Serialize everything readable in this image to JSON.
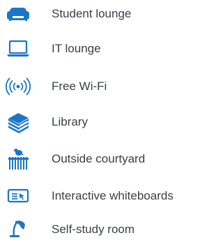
{
  "accent_color": "#1d75c8",
  "text_color": "#3a3f47",
  "amenities": [
    {
      "icon": "sofa-icon",
      "label": "Student lounge"
    },
    {
      "icon": "laptop-icon",
      "label": "IT lounge"
    },
    {
      "icon": "wifi-icon",
      "label": "Free Wi-Fi"
    },
    {
      "icon": "books-icon",
      "label": "Library"
    },
    {
      "icon": "bird-fence-icon",
      "label": "Outside courtyard"
    },
    {
      "icon": "whiteboard-icon",
      "label": "Interactive whiteboards"
    },
    {
      "icon": "desk-lamp-icon",
      "label": "Self-study room"
    }
  ]
}
